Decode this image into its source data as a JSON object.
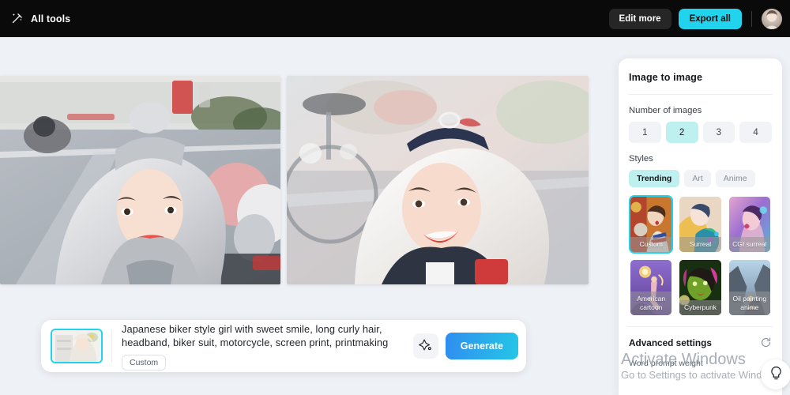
{
  "topbar": {
    "wand_icon": "magic-wand-icon",
    "all_tools_label": "All tools",
    "edit_more_label": "Edit more",
    "export_all_label": "Export all",
    "avatar": "user-avatar",
    "bg_color": "#0a0a0a",
    "export_color": "#22d3ee"
  },
  "results": [
    {
      "alt": "generated-image-1-biker-girl-gray-hair"
    },
    {
      "alt": "generated-image-2-biker-girl-white-hair"
    }
  ],
  "prompt": {
    "thumbnail_alt": "source-image-thumbnail",
    "text": "Japanese biker style girl with sweet smile, long curly hair, headband, biker suit, motorcycle, screen print, printmaking",
    "tag": "Custom",
    "sparkle_icon": "sparkle-icon",
    "generate_label": "Generate",
    "generate_gradient": [
      "#2f8ef0",
      "#25c6e6"
    ]
  },
  "panel": {
    "title": "Image to image",
    "number_of_images": {
      "label": "Number of images",
      "options": [
        "1",
        "2",
        "3",
        "4"
      ],
      "selected": "2",
      "selected_color": "#bdf0ef"
    },
    "styles": {
      "label": "Styles",
      "tabs": [
        "Trending",
        "Art",
        "Anime"
      ],
      "selected_tab": "Trending",
      "cards": [
        {
          "name": "Custom",
          "selected": true
        },
        {
          "name": "Surreal",
          "selected": false
        },
        {
          "name": "CGI surreal",
          "selected": false
        },
        {
          "name": "American cartoon",
          "selected": false
        },
        {
          "name": "Cyberpunk",
          "selected": false
        },
        {
          "name": "Oil painting anime",
          "selected": false
        }
      ],
      "selection_color": "#22d3ee"
    },
    "advanced": {
      "title": "Advanced settings",
      "reset_icon": "reset-icon",
      "word_prompt_weight_label": "Word prompt weight"
    }
  },
  "watermark": {
    "line1": "Activate Windows",
    "line2": "Go to Settings to activate Windows."
  },
  "help": {
    "icon": "lightbulb-icon"
  }
}
